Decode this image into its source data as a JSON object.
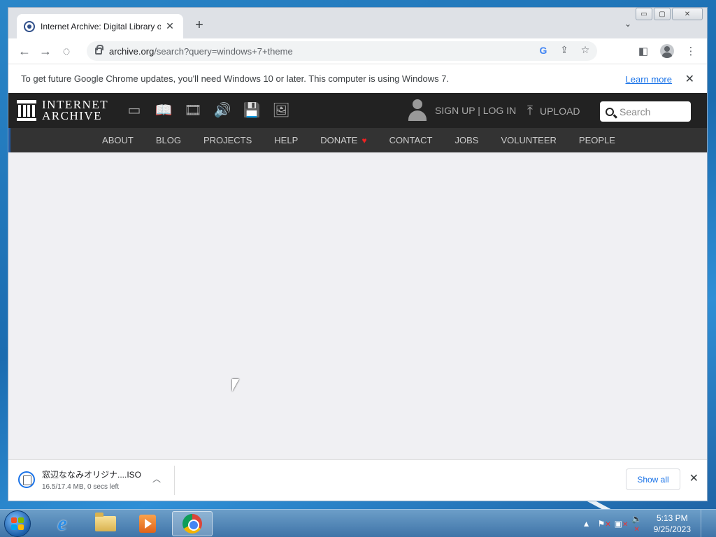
{
  "browser": {
    "tab_title": "Internet Archive: Digital Library o",
    "tab_close": "✕",
    "new_tab": "+",
    "tab_search": "⌄",
    "url_domain": "archive.org",
    "url_path": "/search?query=windows+7+theme",
    "window_controls": {
      "minimize": "▭",
      "maximize": "▢",
      "close": "✕"
    }
  },
  "infobar": {
    "message": "To get future Google Chrome updates, you'll need Windows 10 or later. This computer is using Windows 7.",
    "link": "Learn more",
    "close": "✕"
  },
  "ia_header": {
    "logo_line1": "INTERNET",
    "logo_line2": "ARCHIVE",
    "signup_login": "SIGN UP | LOG IN",
    "upload": "UPLOAD",
    "search_placeholder": "Search",
    "media_icons": [
      "web-icon",
      "texts-icon",
      "video-icon",
      "audio-icon",
      "software-icon",
      "images-icon"
    ]
  },
  "ia_nav": {
    "items": [
      "ABOUT",
      "BLOG",
      "PROJECTS",
      "HELP",
      "DONATE",
      "CONTACT",
      "JOBS",
      "VOLUNTEER",
      "PEOPLE"
    ],
    "heart_color": "#e22222"
  },
  "download_shelf": {
    "file_name": "窓辺ななみオリジナ....ISO",
    "status": "16.5/17.4 MB, 0 secs left",
    "show_all": "Show all",
    "close": "✕"
  },
  "taskbar": {
    "time": "5:13 PM",
    "date": "9/25/2023"
  },
  "colors": {
    "ia_top_bg": "#222222",
    "ia_nav_bg": "#333333",
    "link_blue": "#1a73e8"
  }
}
